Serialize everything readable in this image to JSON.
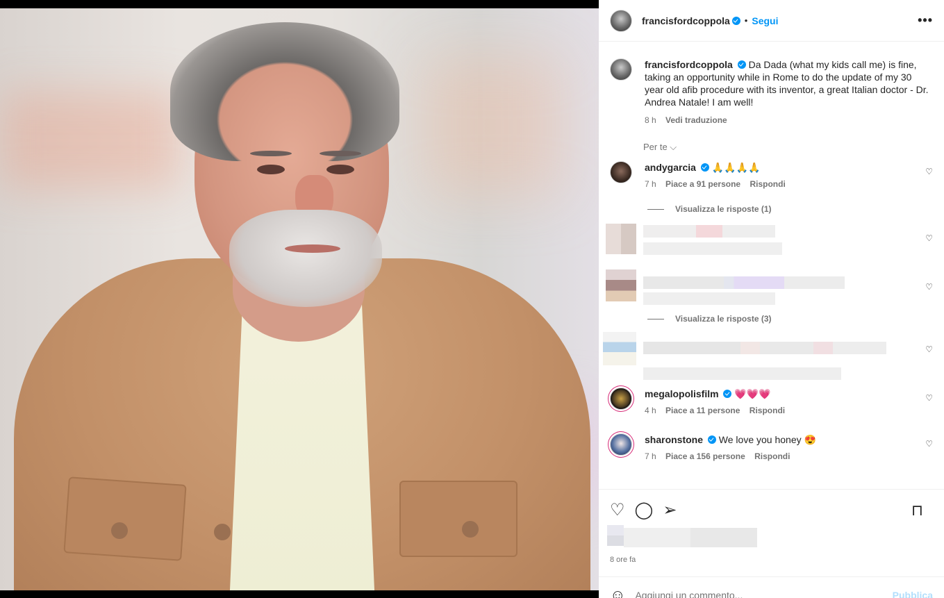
{
  "post": {
    "author": "francisfordcoppola",
    "follow_label": "Segui",
    "more_label": "•••",
    "caption": "Da Dada (what my kids call me) is fine, taking an opportunity while in Rome to do the update of my 30 year old afib procedure with its inventor, a great Italian doctor - Dr. Andrea Natale! I am well!",
    "caption_time": "8 h",
    "translate_label": "Vedi traduzione",
    "for_you_label": "Per te ⌵",
    "time_ago": "8 ore fa"
  },
  "comments": [
    {
      "user": "andygarcia",
      "text": "🙏🙏🙏🙏",
      "time": "7 h",
      "likes": "Piace a 91 persone",
      "reply": "Rispondi",
      "replies_label": "Visualizza le risposte (1)"
    },
    {
      "user": "megalopolisfilm",
      "text": "💗💗💗",
      "time": "4 h",
      "likes": "Piace a 11 persone",
      "reply": "Rispondi"
    },
    {
      "user": "sharonstone",
      "text": "We love you honey 😍",
      "time": "7 h",
      "likes": "Piace a 156 persone",
      "reply": "Rispondi"
    }
  ],
  "hidden_replies_label": "Visualizza le risposte (3)",
  "add_comment": {
    "placeholder": "Aggiungi un commento...",
    "publish": "Pubblica"
  },
  "icons": {
    "like": "heart-icon",
    "comment": "comment-icon",
    "share": "send-icon",
    "save": "bookmark-icon",
    "emoji": "emoji-icon"
  },
  "colors": {
    "accent": "#0095f6",
    "verified": "#0095f6",
    "publish_disabled": "#b2dffc"
  }
}
